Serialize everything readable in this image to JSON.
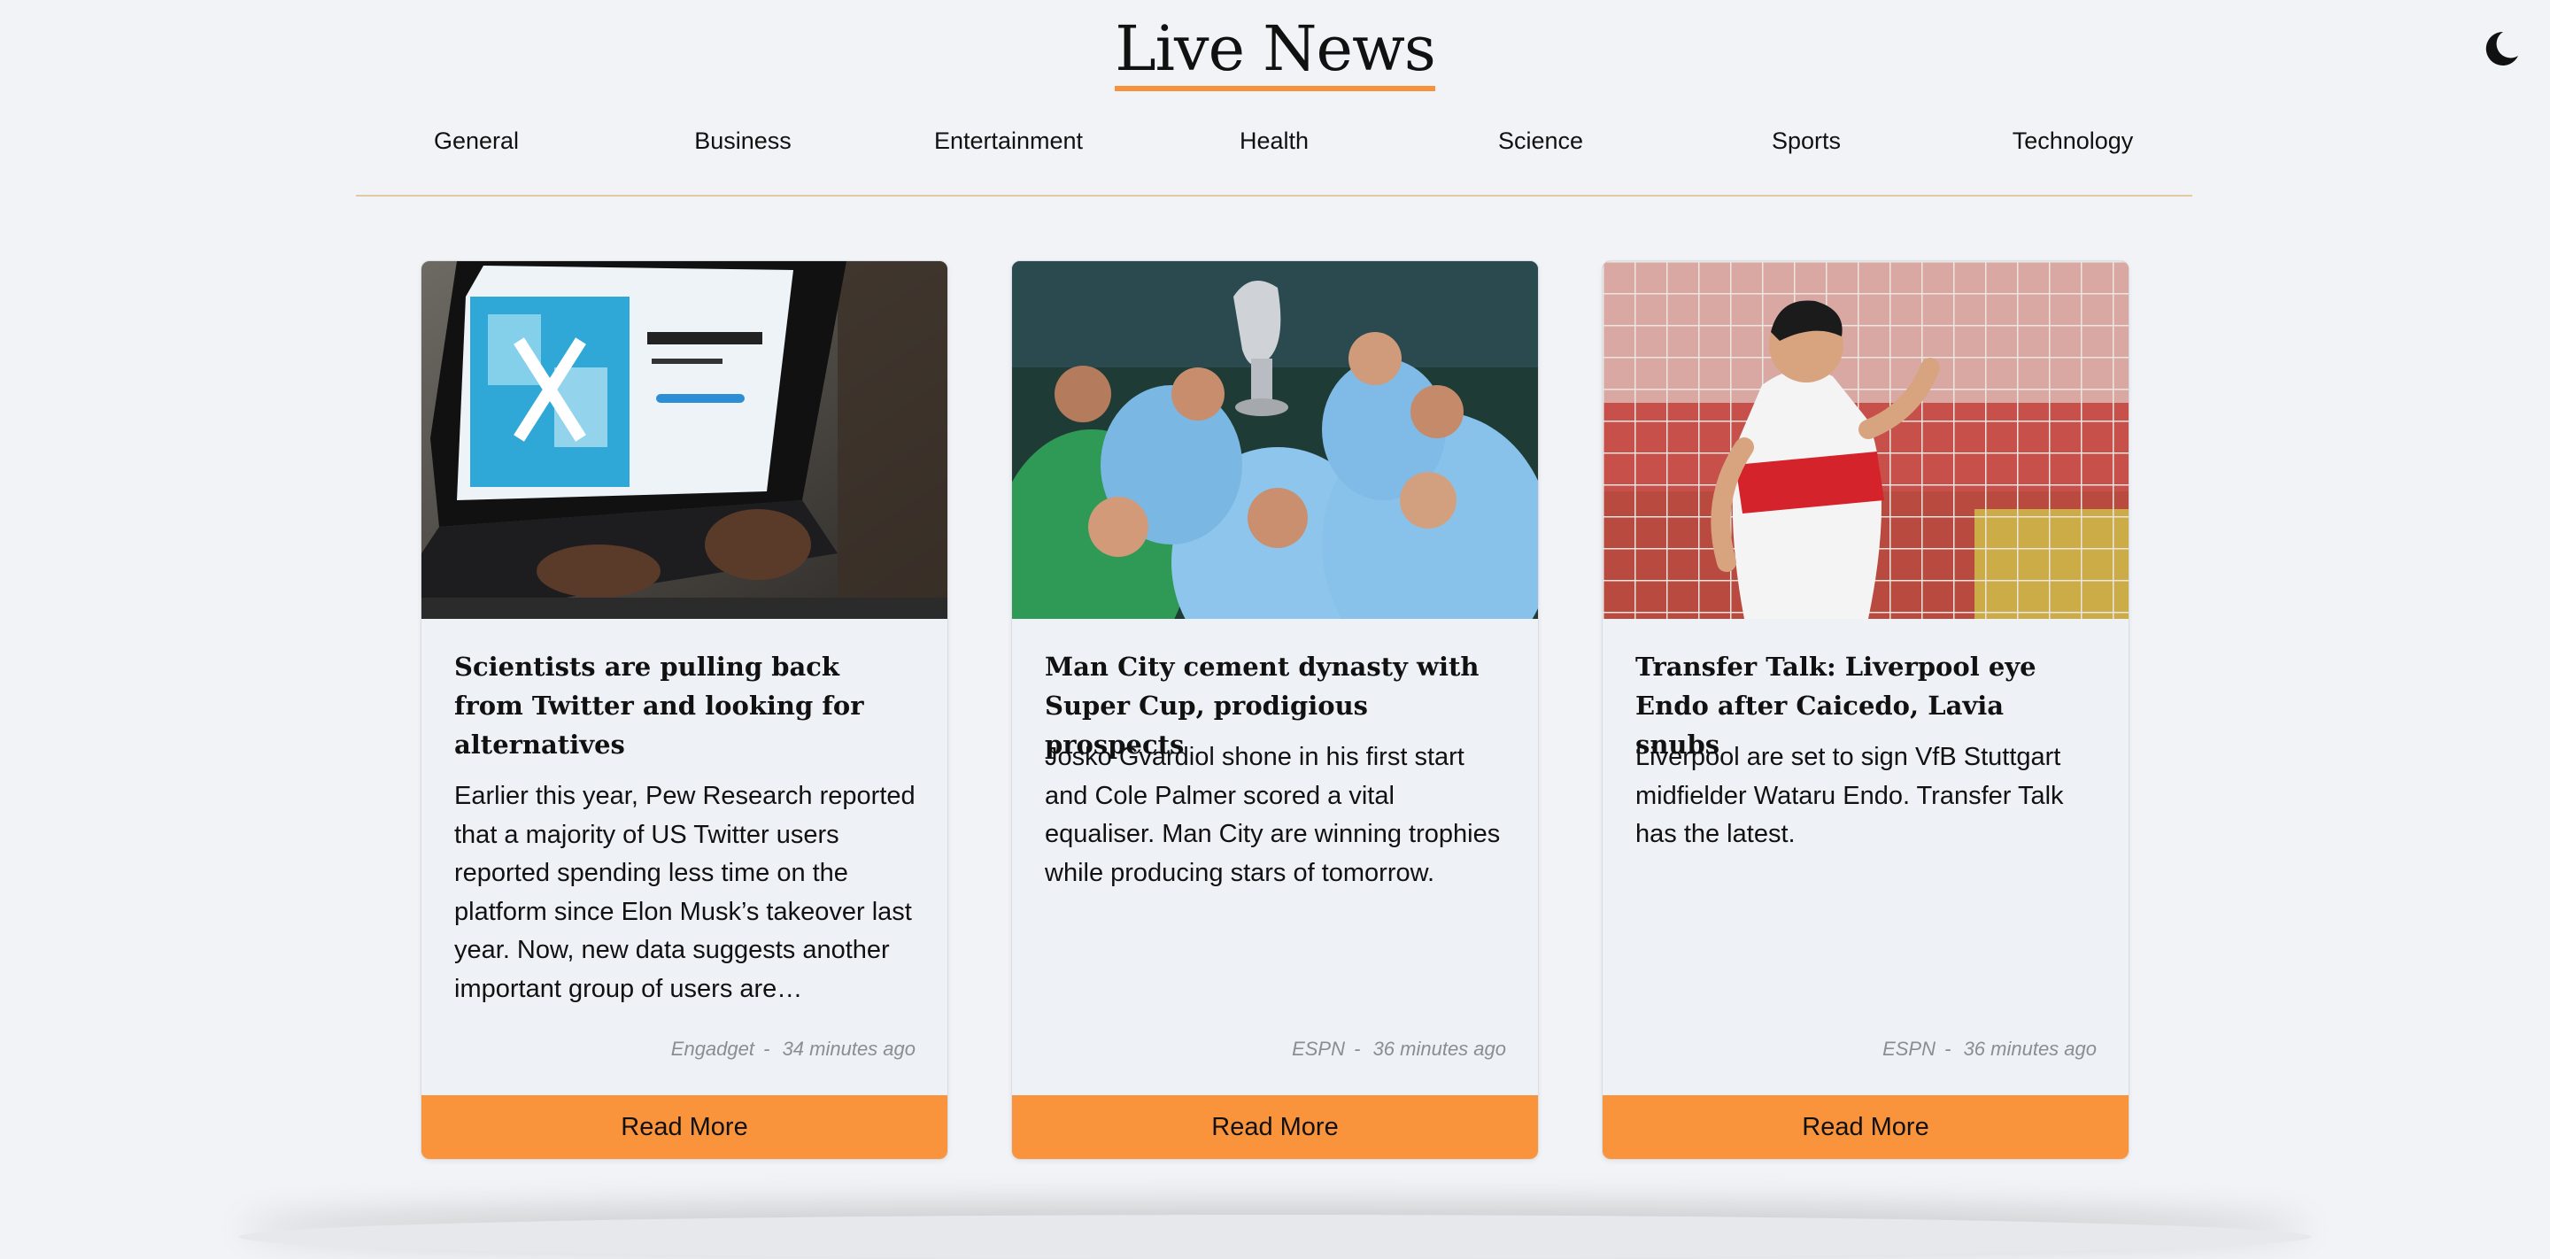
{
  "site": {
    "title": "Live News"
  },
  "theme_toggle": {
    "icon": "moon-icon"
  },
  "nav": {
    "items": [
      "General",
      "Business",
      "Entertainment",
      "Health",
      "Science",
      "Sports",
      "Technology"
    ]
  },
  "articles": [
    {
      "title": "Scientists are pulling back from Twitter and looking for alternatives",
      "description": "Earlier this year, Pew Research reported that a majority of US Twitter users reported spending less time on the platform since Elon Musk’s takeover last year. Now, new data suggests another important group of users are…",
      "source": "Engadget",
      "separator": "-",
      "time": "34 minutes ago",
      "button": "Read More",
      "image": "laptop-twitter-photo"
    },
    {
      "title": "Man City cement dynasty with Super Cup, prodigious prospects",
      "description": "Josko Gvardiol shone in his first start and Cole Palmer scored a vital equaliser. Man City are winning trophies while producing stars of tomorrow.",
      "source": "ESPN",
      "separator": "-",
      "time": "36 minutes ago",
      "button": "Read More",
      "image": "trophy-celebration-photo"
    },
    {
      "title": "Transfer Talk: Liverpool eye Endo after Caicedo, Lavia snubs",
      "description": "Liverpool are set to sign VfB Stuttgart midfielder Wataru Endo. Transfer Talk has the latest.",
      "source": "ESPN",
      "separator": "-",
      "time": "36 minutes ago",
      "button": "Read More",
      "image": "footballer-photo"
    }
  ],
  "colors": {
    "accent": "#f9943d",
    "background": "#f1f3f6",
    "card": "#eef2f7"
  }
}
